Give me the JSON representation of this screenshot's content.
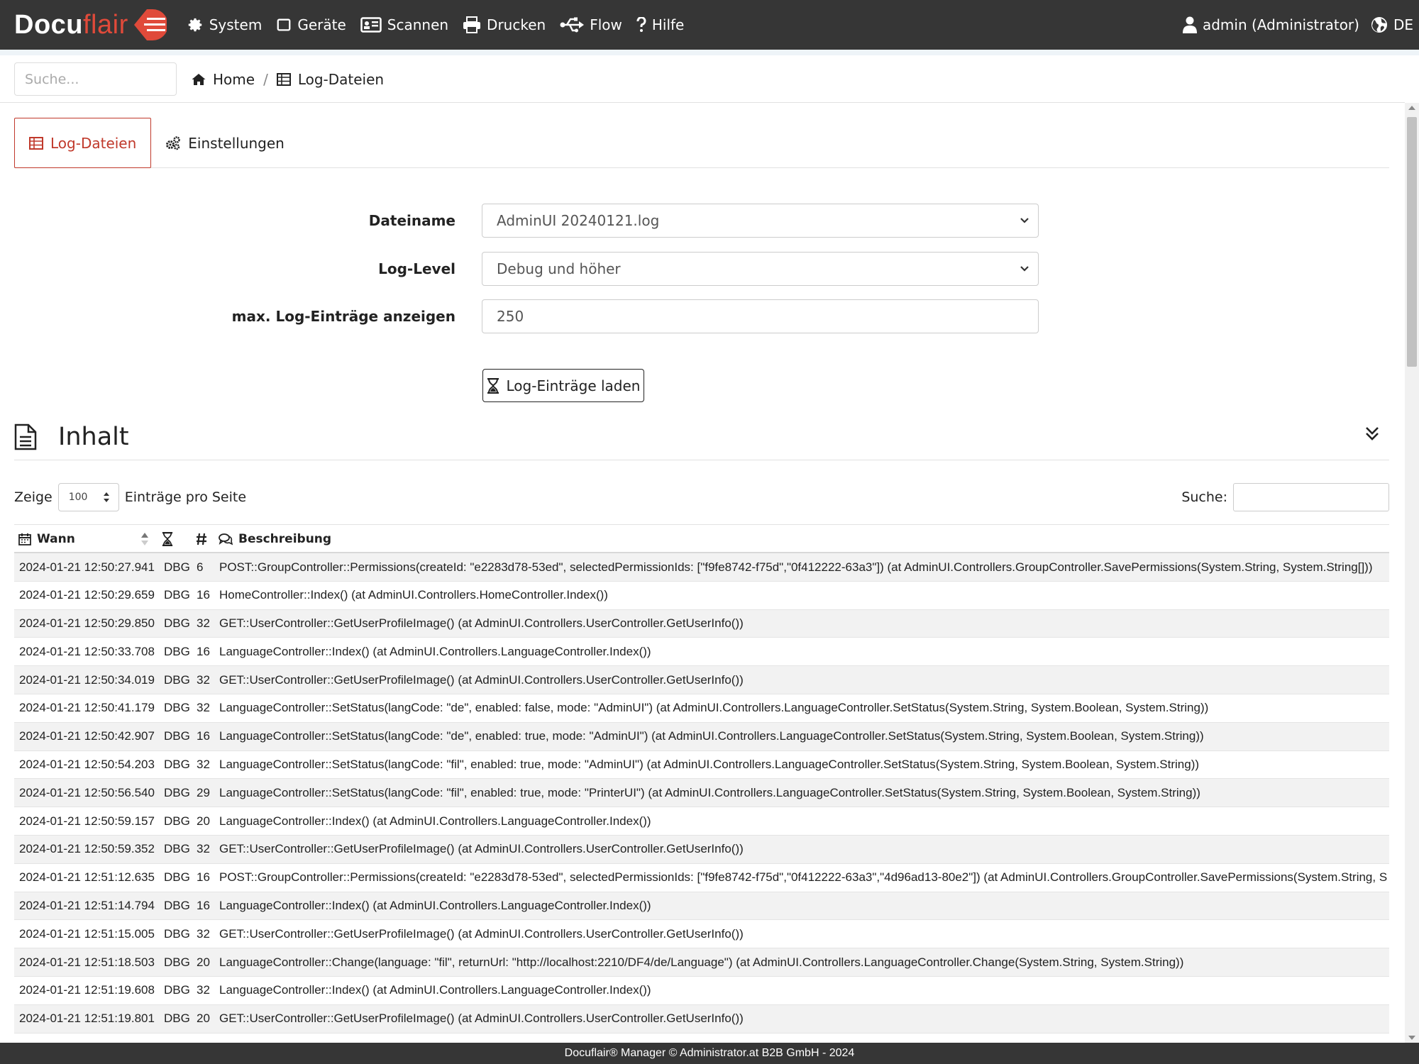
{
  "brand": {
    "text_bold": "Docu",
    "text_light": "flair"
  },
  "nav": {
    "items": [
      {
        "label": "System",
        "icon": "gear-icon"
      },
      {
        "label": "Geräte",
        "icon": "square-icon"
      },
      {
        "label": "Scannen",
        "icon": "scanner-icon"
      },
      {
        "label": "Drucken",
        "icon": "printer-icon"
      },
      {
        "label": "Flow",
        "icon": "usb-icon"
      },
      {
        "label": "Hilfe",
        "icon": "question-icon"
      }
    ],
    "user": "admin (Administrator)",
    "language": "DE"
  },
  "search": {
    "placeholder": "Suche..."
  },
  "breadcrumb": {
    "home": "Home",
    "sep": "/",
    "current": "Log-Dateien"
  },
  "tabs": [
    {
      "label": "Log-Dateien",
      "active": true
    },
    {
      "label": "Einstellungen",
      "active": false
    }
  ],
  "form": {
    "filename_label": "Dateiname",
    "filename_value": "AdminUI 20240121.log",
    "loglevel_label": "Log-Level",
    "loglevel_value": "Debug und höher",
    "max_label": "max. Log-Einträge anzeigen",
    "max_value": "250",
    "load_button": "Log-Einträge laden"
  },
  "content": {
    "title": "Inhalt",
    "show_label": "Zeige",
    "page_size": "100",
    "per_page_label": "Einträge pro Seite",
    "search_label": "Suche:"
  },
  "table": {
    "columns": {
      "when": "Wann",
      "duration": "",
      "num": "#",
      "desc": "Beschreibung"
    },
    "rows": [
      {
        "when": "2024-01-21 12:50:27.941",
        "lvl": "DBG",
        "num": "6",
        "desc": "POST::GroupController::Permissions(createId: \"e2283d78-53ed\", selectedPermissionIds: [\"f9fe8742-f75d\",\"0f412222-63a3\"]) (at AdminUI.Controllers.GroupController.SavePermissions(System.String, System.String[]))"
      },
      {
        "when": "2024-01-21 12:50:29.659",
        "lvl": "DBG",
        "num": "16",
        "desc": "HomeController::Index() (at AdminUI.Controllers.HomeController.Index())"
      },
      {
        "when": "2024-01-21 12:50:29.850",
        "lvl": "DBG",
        "num": "32",
        "desc": "GET::UserController::GetUserProfileImage() (at AdminUI.Controllers.UserController.GetUserInfo())"
      },
      {
        "when": "2024-01-21 12:50:33.708",
        "lvl": "DBG",
        "num": "16",
        "desc": "LanguageController::Index() (at AdminUI.Controllers.LanguageController.Index())"
      },
      {
        "when": "2024-01-21 12:50:34.019",
        "lvl": "DBG",
        "num": "32",
        "desc": "GET::UserController::GetUserProfileImage() (at AdminUI.Controllers.UserController.GetUserInfo())"
      },
      {
        "when": "2024-01-21 12:50:41.179",
        "lvl": "DBG",
        "num": "32",
        "desc": "LanguageController::SetStatus(langCode: \"de\", enabled: false, mode: \"AdminUI\") (at AdminUI.Controllers.LanguageController.SetStatus(System.String, System.Boolean, System.String))"
      },
      {
        "when": "2024-01-21 12:50:42.907",
        "lvl": "DBG",
        "num": "16",
        "desc": "LanguageController::SetStatus(langCode: \"de\", enabled: true, mode: \"AdminUI\") (at AdminUI.Controllers.LanguageController.SetStatus(System.String, System.Boolean, System.String))"
      },
      {
        "when": "2024-01-21 12:50:54.203",
        "lvl": "DBG",
        "num": "32",
        "desc": "LanguageController::SetStatus(langCode: \"fil\", enabled: true, mode: \"AdminUI\") (at AdminUI.Controllers.LanguageController.SetStatus(System.String, System.Boolean, System.String))"
      },
      {
        "when": "2024-01-21 12:50:56.540",
        "lvl": "DBG",
        "num": "29",
        "desc": "LanguageController::SetStatus(langCode: \"fil\", enabled: true, mode: \"PrinterUI\") (at AdminUI.Controllers.LanguageController.SetStatus(System.String, System.Boolean, System.String))"
      },
      {
        "when": "2024-01-21 12:50:59.157",
        "lvl": "DBG",
        "num": "20",
        "desc": "LanguageController::Index() (at AdminUI.Controllers.LanguageController.Index())"
      },
      {
        "when": "2024-01-21 12:50:59.352",
        "lvl": "DBG",
        "num": "32",
        "desc": "GET::UserController::GetUserProfileImage() (at AdminUI.Controllers.UserController.GetUserInfo())"
      },
      {
        "when": "2024-01-21 12:51:12.635",
        "lvl": "DBG",
        "num": "16",
        "desc": "POST::GroupController::Permissions(createId: \"e2283d78-53ed\", selectedPermissionIds: [\"f9fe8742-f75d\",\"0f412222-63a3\",\"4d96ad13-80e2\"]) (at AdminUI.Controllers.GroupController.SavePermissions(System.String, S"
      },
      {
        "when": "2024-01-21 12:51:14.794",
        "lvl": "DBG",
        "num": "16",
        "desc": "LanguageController::Index() (at AdminUI.Controllers.LanguageController.Index())"
      },
      {
        "when": "2024-01-21 12:51:15.005",
        "lvl": "DBG",
        "num": "32",
        "desc": "GET::UserController::GetUserProfileImage() (at AdminUI.Controllers.UserController.GetUserInfo())"
      },
      {
        "when": "2024-01-21 12:51:18.503",
        "lvl": "DBG",
        "num": "20",
        "desc": "LanguageController::Change(language: \"fil\", returnUrl: \"http://localhost:2210/DF4/de/Language\") (at AdminUI.Controllers.LanguageController.Change(System.String, System.String))"
      },
      {
        "when": "2024-01-21 12:51:19.608",
        "lvl": "DBG",
        "num": "32",
        "desc": "LanguageController::Index() (at AdminUI.Controllers.LanguageController.Index())"
      },
      {
        "when": "2024-01-21 12:51:19.801",
        "lvl": "DBG",
        "num": "20",
        "desc": "GET::UserController::GetUserProfileImage() (at AdminUI.Controllers.UserController.GetUserInfo())"
      }
    ]
  },
  "footer": {
    "text": "Docuflair® Manager © Administrator.at B2B GmbH - 2024"
  },
  "colors": {
    "navbar": "#363636",
    "accent": "#c0392b",
    "logo_red": "#e04a3a"
  }
}
